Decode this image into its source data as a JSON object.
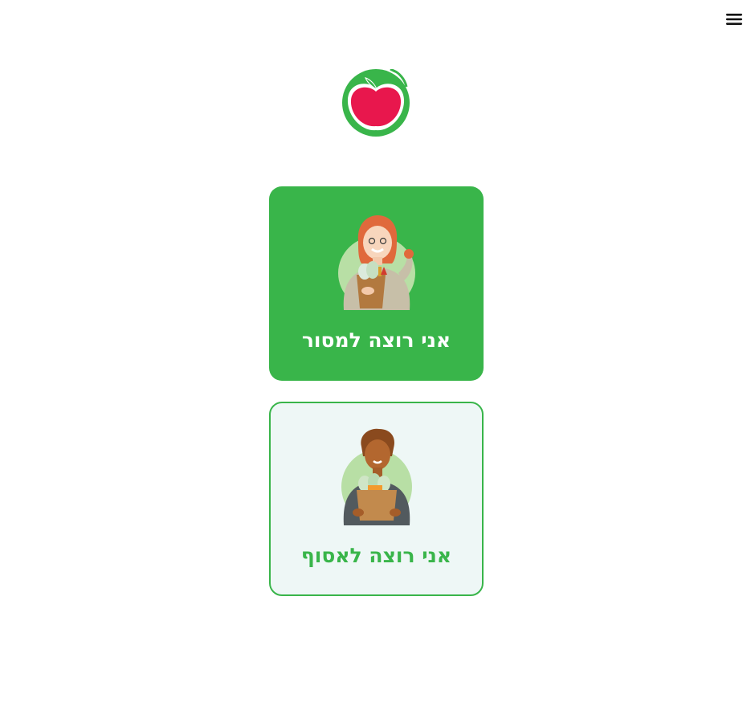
{
  "header": {
    "menu_icon": "hamburger-menu-icon"
  },
  "logo": {
    "icon": "apple-logo-icon"
  },
  "colors": {
    "brand_green": "#39b54a",
    "apple_red": "#e8174d",
    "collect_card_bg": "#eef7f6"
  },
  "options": {
    "donate": {
      "label": "אני רוצה למסור",
      "icon": "woman-holding-groceries-illustration"
    },
    "collect": {
      "label": "אני רוצה לאסוף",
      "icon": "man-holding-groceries-illustration"
    }
  }
}
